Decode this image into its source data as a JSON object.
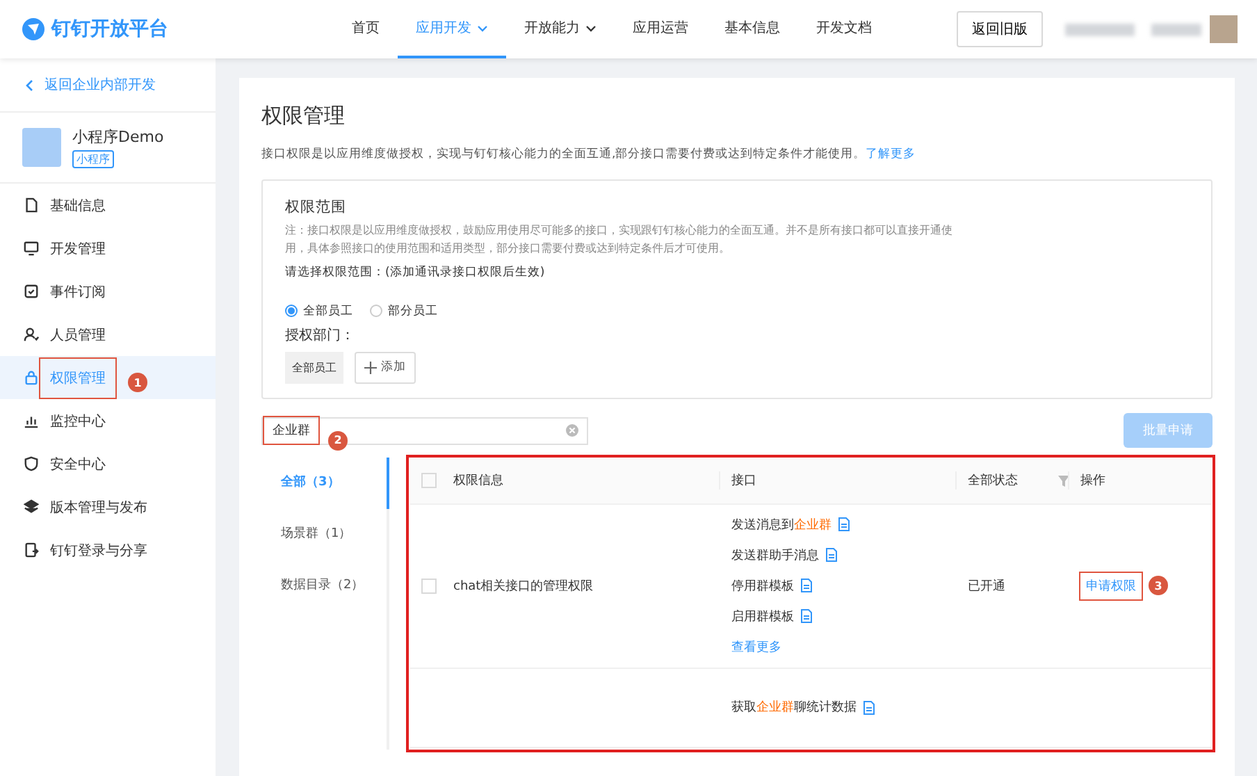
{
  "header": {
    "logo": "钉钉开放平台",
    "nav": [
      {
        "label": "首页",
        "selected": false,
        "dropdown": false
      },
      {
        "label": "应用开发",
        "selected": true,
        "dropdown": true
      },
      {
        "label": "开放能力",
        "selected": false,
        "dropdown": true
      },
      {
        "label": "应用运营",
        "selected": false,
        "dropdown": false
      },
      {
        "label": "基本信息",
        "selected": false,
        "dropdown": false
      },
      {
        "label": "开发文档",
        "selected": false,
        "dropdown": false
      }
    ],
    "old_version_button": "返回旧版"
  },
  "sidebar": {
    "back_link": "返回企业内部开发",
    "app": {
      "name": "小程序Demo",
      "tag": "小程序"
    },
    "items": [
      {
        "label": "基础信息",
        "selected": false
      },
      {
        "label": "开发管理",
        "selected": false
      },
      {
        "label": "事件订阅",
        "selected": false
      },
      {
        "label": "人员管理",
        "selected": false
      },
      {
        "label": "权限管理",
        "selected": true,
        "annotation": "1"
      },
      {
        "label": "监控中心",
        "selected": false
      },
      {
        "label": "安全中心",
        "selected": false
      },
      {
        "label": "版本管理与发布",
        "selected": false
      },
      {
        "label": "钉钉登录与分享",
        "selected": false
      }
    ]
  },
  "main": {
    "title": "权限管理",
    "intro": "接口权限是以应用维度做授权，实现与钉钉核心能力的全面互通,部分接口需要付费或达到特定条件才能使用。",
    "intro_link": "了解更多",
    "scope": {
      "title": "权限范围",
      "note": "注：接口权限是以应用维度做授权，鼓励应用使用尽可能多的接口，实现跟钉钉核心能力的全面互通。并不是所有接口都可以直接开通使用，具体参照接口的使用范围和适用类型，部分接口需要付费或达到特定条件后才可使用。",
      "prompt": "请选择权限范围：(添加通讯录接口权限后生效)",
      "options": [
        {
          "label": "全部员工",
          "selected": true
        },
        {
          "label": "部分员工",
          "selected": false
        }
      ],
      "dept_label": "授权部门：",
      "dept_tags": [
        "全部员工"
      ],
      "add_button": "添加"
    },
    "search": {
      "value": "企业群",
      "annotation": "2"
    },
    "batch_button": {
      "label": "批量申请",
      "disabled": true
    },
    "categories": [
      {
        "label": "全部（3）",
        "selected": true
      },
      {
        "label": "场景群（1）",
        "selected": false
      },
      {
        "label": "数据目录（2）",
        "selected": false
      }
    ],
    "table": {
      "columns": [
        "权限信息",
        "接口",
        "全部状态",
        "操作"
      ],
      "highlighted": true,
      "rows": [
        {
          "checked": false,
          "name": "chat相关接口的管理权限",
          "interfaces": [
            {
              "before": "发送消息到",
              "keyword": "企业群"
            },
            {
              "before": "发送群助手消息"
            },
            {
              "before": "停用群模板"
            },
            {
              "before": "启用群模板"
            }
          ],
          "more": "查看更多",
          "status": "已开通",
          "action": "申请权限",
          "annotation": "3"
        },
        {
          "interfaces": [
            {
              "before": "获取",
              "keyword": "企业群",
              "after": "聊统计数据"
            }
          ]
        }
      ]
    }
  }
}
